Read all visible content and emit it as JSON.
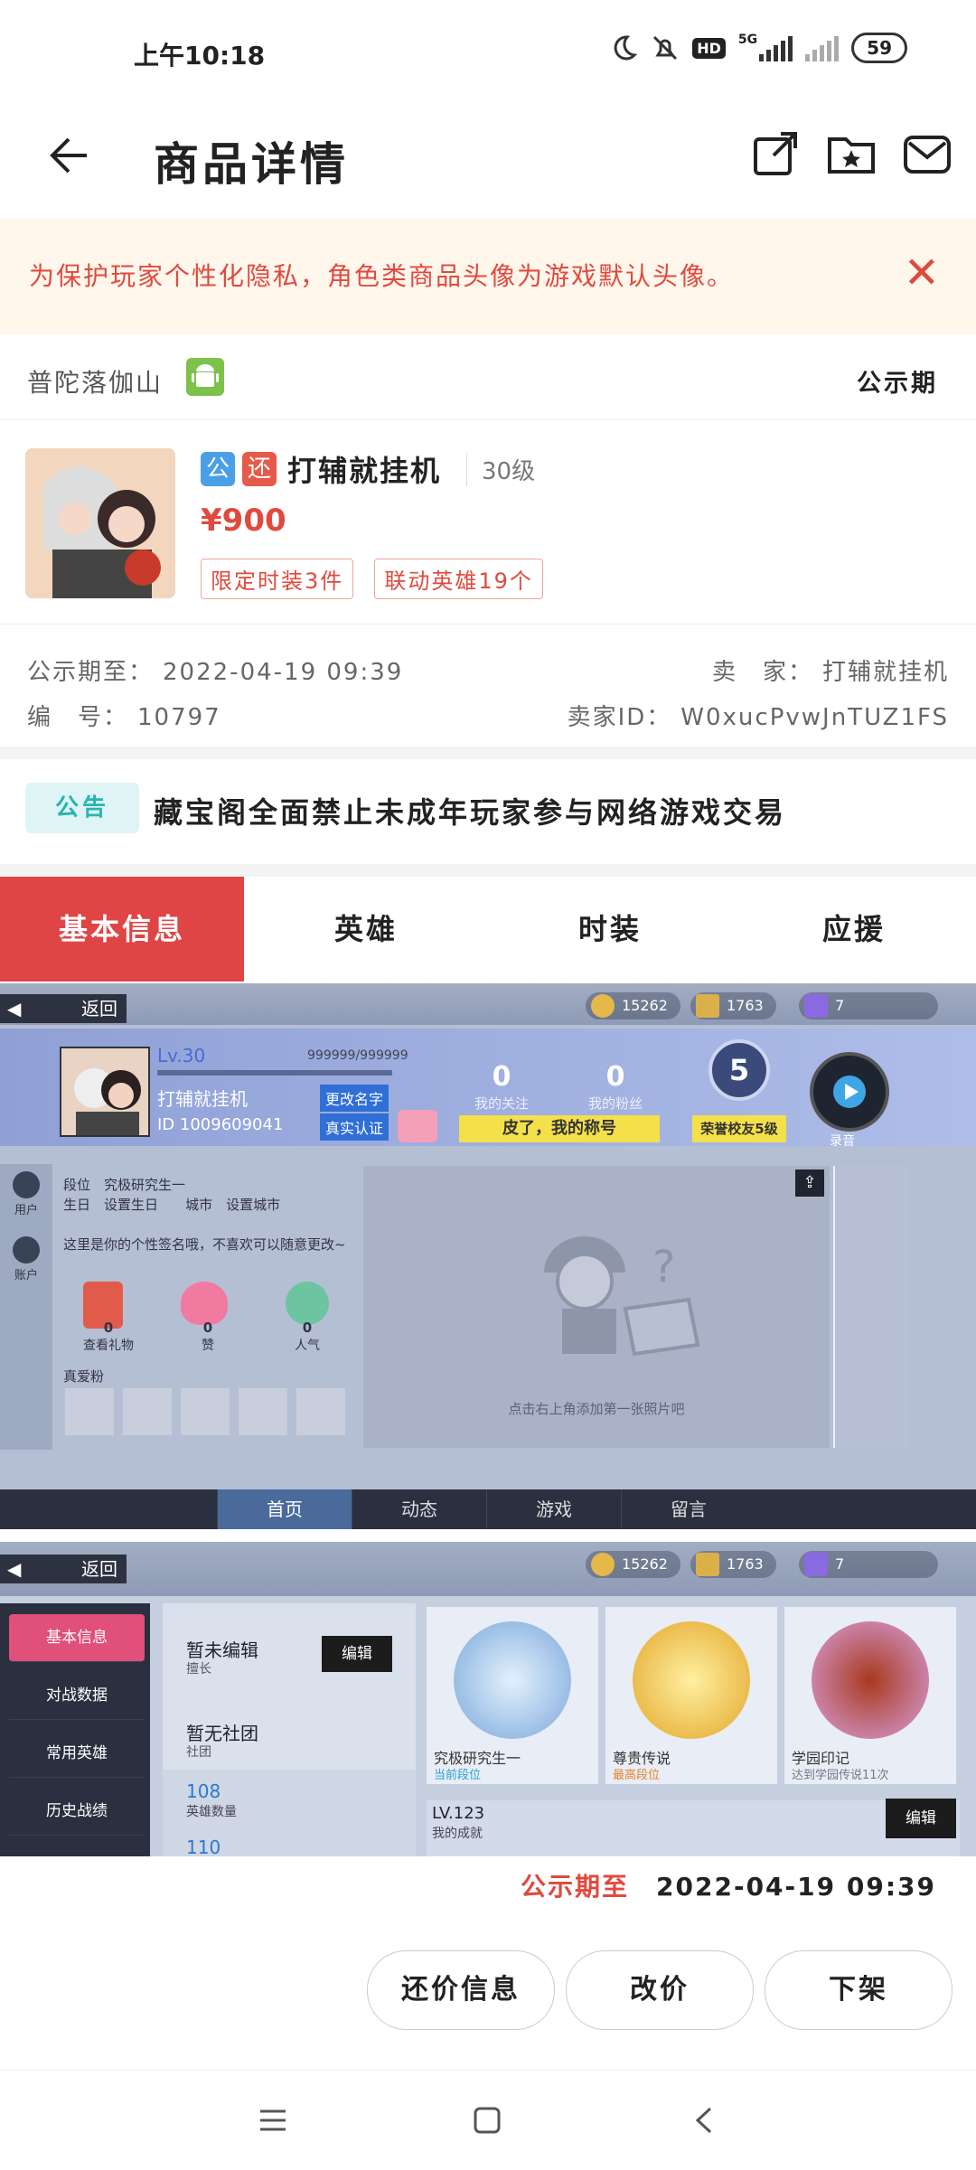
{
  "status_bar": {
    "time": "上午10:18",
    "network": "5G",
    "hd": "HD",
    "battery": "59"
  },
  "header": {
    "title": "商品详情",
    "icons": [
      "back-arrow-icon",
      "share-icon",
      "favorite-folder-icon",
      "message-icon"
    ]
  },
  "notice": {
    "text": "为保护玩家个性化隐私，角色类商品头像为游戏默认头像。"
  },
  "server": {
    "name": "普陀落伽山",
    "platform_icon": "android-icon",
    "status": "公示期"
  },
  "product": {
    "tag_public": "公",
    "tag_bargain": "还",
    "name": "打辅就挂机",
    "level": "30级",
    "price": "¥900",
    "chips": [
      "限定时装3件",
      "联动英雄19个"
    ]
  },
  "meta": {
    "public_until_label": "公示期至：",
    "public_until": "2022-04-19 09:39",
    "id_label": "编　号：",
    "id": "10797",
    "seller_label": "卖　家：",
    "seller": "打辅就挂机",
    "seller_id_label": "卖家ID：",
    "seller_id": "W0xucPvwJnTUZ1FS"
  },
  "announcement": {
    "badge": "公告",
    "text": "藏宝阁全面禁止未成年玩家参与网络游戏交易"
  },
  "tabs": [
    "基本信息",
    "英雄",
    "时装",
    "应援"
  ],
  "shot1": {
    "back": "返回",
    "resources": [
      "15262",
      "1763",
      "7"
    ],
    "level": "Lv.30",
    "exp": "999999/999999",
    "player_name": "打辅就挂机",
    "player_id": "ID 1009609041",
    "rename": "更改名字",
    "verify": "真实认证",
    "follow_count": "0",
    "follow_label": "我的关注",
    "fans_count": "0",
    "fans_label": "我的粉丝",
    "title_bar": "皮了，我的称号",
    "honor_num": "5",
    "honor": "荣誉校友5级",
    "record": "录音",
    "side_user": "用户",
    "side_acc": "账户",
    "rank_label": "段位",
    "rank_value": "究极研究生一",
    "birthday_label": "生日",
    "birthday_value": "设置生日",
    "city_label": "城市",
    "city_value": "设置城市",
    "signature": "这里是你的个性签名哦，不喜欢可以随意更改~",
    "gifts": [
      {
        "n": "0",
        "l": "查看礼物"
      },
      {
        "n": "0",
        "l": "赞"
      },
      {
        "n": "0",
        "l": "人气"
      }
    ],
    "true_fans": "真爱粉",
    "photo_hint": "点击右上角添加第一张照片吧",
    "nav": [
      "首页",
      "动态",
      "游戏",
      "留言"
    ]
  },
  "shot2": {
    "back": "返回",
    "resources": [
      "15262",
      "1763",
      "7"
    ],
    "side": [
      "基本信息",
      "对战数据",
      "常用英雄",
      "历史战绩"
    ],
    "unedited": "暂未编辑",
    "strength": "擅长",
    "edit": "编辑",
    "no_club": "暂无社团",
    "club": "社团",
    "hero_count": "108",
    "hero_label": "英雄数量",
    "partial": "110",
    "cards": [
      {
        "title": "究极研究生一",
        "sub": "当前段位"
      },
      {
        "title": "尊贵传说",
        "sub": "最高段位"
      },
      {
        "title": "学园印记",
        "sub": "达到学园传说11次"
      }
    ],
    "achv_level": "LV.123",
    "achv_label": "我的成就",
    "edit2": "编辑"
  },
  "bottom": {
    "public_until_label": "公示期至",
    "public_until": "2022-04-19 09:39",
    "buttons": [
      "还价信息",
      "改价",
      "下架"
    ]
  },
  "colors": {
    "accent": "#e04545",
    "price": "#e04a3e",
    "notice_bg": "#fff6ec"
  }
}
